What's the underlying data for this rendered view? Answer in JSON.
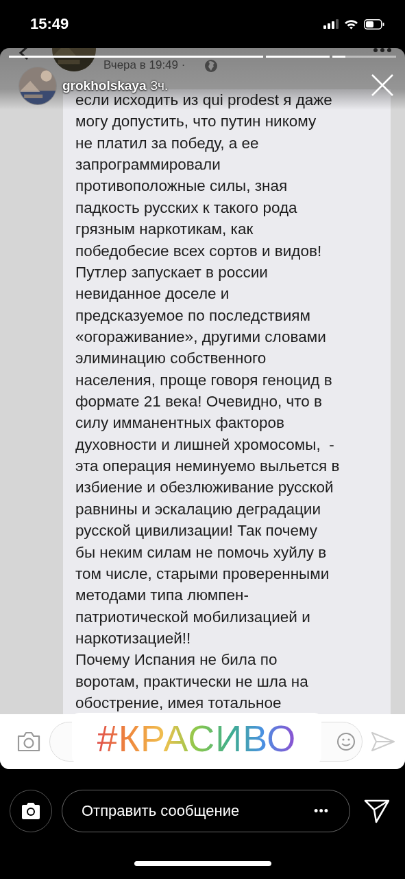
{
  "status_bar": {
    "time": "15:49"
  },
  "story": {
    "progress": [
      {
        "level": 1
      },
      {
        "level": 1
      },
      {
        "level": 0.2
      }
    ],
    "username": "grokholskaya",
    "age": "3ч."
  },
  "post": {
    "date": "Вчера в 19:49 ·",
    "lines": [
      "если исходить из qui prodest я даже",
      "могу допустить, что путин никому",
      "не платил за победу, а ее",
      "запрограммировали",
      "противоположные силы, зная",
      "падкость русских к такого рода",
      "грязным наркотикам, как",
      "победобесие всех сортов и видов!",
      "Путлер запускает в россии",
      "невиданное доселе и",
      "предсказуемое по последствиям",
      "«огораживание», другими словами",
      "элиминацию собственного",
      "населения, проще говоря геноцид в",
      "формате 21 века! Очевидно, что в",
      "силу имманентных факторов",
      "духовности и лишней хромосомы,  -",
      "эта операция неминуемо выльется в",
      "избиение и обезлюживание русской",
      "равнины и эскалацию деградации",
      "русской цивилизации! Так почему",
      "бы неким силам не помочь хуйлу в",
      "том числе, старыми проверенными",
      "методами типа люмпен-",
      "патриотической мобилизацией и",
      "наркотизацией!!",
      "Почему Испания не била по",
      "воротам, практически не шла на",
      "обострение, имея тотальное"
    ]
  },
  "sticker": {
    "text": "#КРАСИВО"
  },
  "reply_bar": {
    "placeholder": "Отправить сообщение",
    "more": "•••"
  }
}
